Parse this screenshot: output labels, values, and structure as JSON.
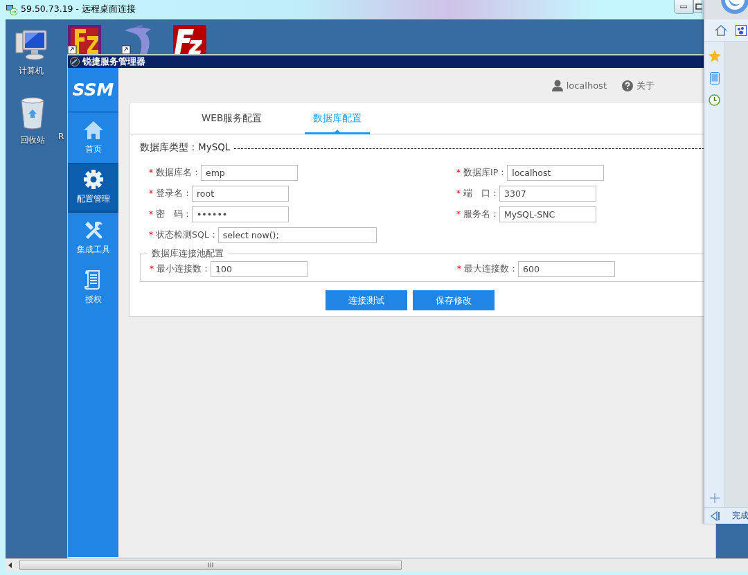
{
  "rdp_window": {
    "title": "59.50.73.19 - 远程桌面连接"
  },
  "desktop": {
    "icons": [
      {
        "kind": "computer",
        "label": "计算机"
      },
      {
        "kind": "recycle-bin",
        "label": "回收站"
      },
      {
        "kind": "hidden",
        "label": "R"
      },
      {
        "kind": "server-app"
      },
      {
        "kind": "dolphin-app"
      },
      {
        "kind": "ftp-app"
      }
    ]
  },
  "app": {
    "title": "锐捷服务管理器",
    "logo": "SSM",
    "nav": [
      {
        "label": "首页",
        "selected": false
      },
      {
        "label": "配置管理",
        "selected": true
      },
      {
        "label": "集成工具",
        "selected": false
      },
      {
        "label": "授权",
        "selected": false
      }
    ],
    "user": "localhost",
    "about": "关于",
    "tabs": [
      {
        "label": "WEB服务配置",
        "selected": false
      },
      {
        "label": "数据库配置",
        "selected": true
      }
    ],
    "section_title": "数据库类型：MySQL",
    "fields_left": [
      {
        "mark": "*",
        "label": "数据库名：",
        "value": "emp"
      },
      {
        "mark": "*",
        "label": "登录名：",
        "value": "root"
      },
      {
        "mark": "*",
        "label": "密　码：",
        "value": "••••••"
      },
      {
        "mark": "*",
        "label": "状态检测SQL：",
        "value": "select now();"
      }
    ],
    "fields_right": [
      {
        "mark": "*",
        "label": "数据库IP：",
        "value": "localhost"
      },
      {
        "mark": "*",
        "label": "端　口：",
        "value": "3307"
      },
      {
        "mark": "*",
        "label": "服务名：",
        "value": "MySQL-SNC"
      }
    ],
    "pool": {
      "legend": "数据库连接池配置",
      "fields": [
        {
          "mark": "*",
          "label": "最小连接数：",
          "value": "100"
        },
        {
          "mark": "*",
          "label": "最大连接数：",
          "value": "600"
        }
      ]
    },
    "buttons": [
      "连接测试",
      "保存修改"
    ]
  },
  "browser_panel": {
    "status": "完成"
  }
}
